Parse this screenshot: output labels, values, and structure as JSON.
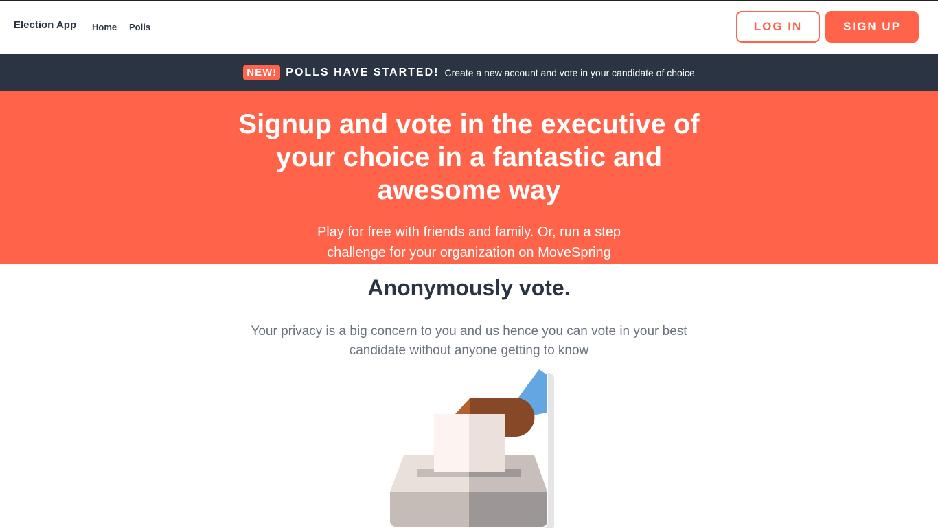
{
  "nav": {
    "brand": "Election App",
    "links": [
      "Home",
      "Polls"
    ],
    "login": "LOG IN",
    "signup": "SIGN UP"
  },
  "banner": {
    "badge": "NEW!",
    "title": "POLLS HAVE STARTED!",
    "text": "Create a new account and vote in your candidate of choice"
  },
  "hero": {
    "title": "Signup and vote in the executive of your choice in a fantastic and awesome way",
    "subtitle": "Play for free with friends and family. Or, run a step challenge for your organization on MoveSpring"
  },
  "feature": {
    "title": "Anonymously vote.",
    "text": "Your privacy is a big concern to you and us hence you can vote in your best candidate without anyone getting to know"
  },
  "colors": {
    "accent": "#ff634a",
    "dark": "#2b3442"
  }
}
